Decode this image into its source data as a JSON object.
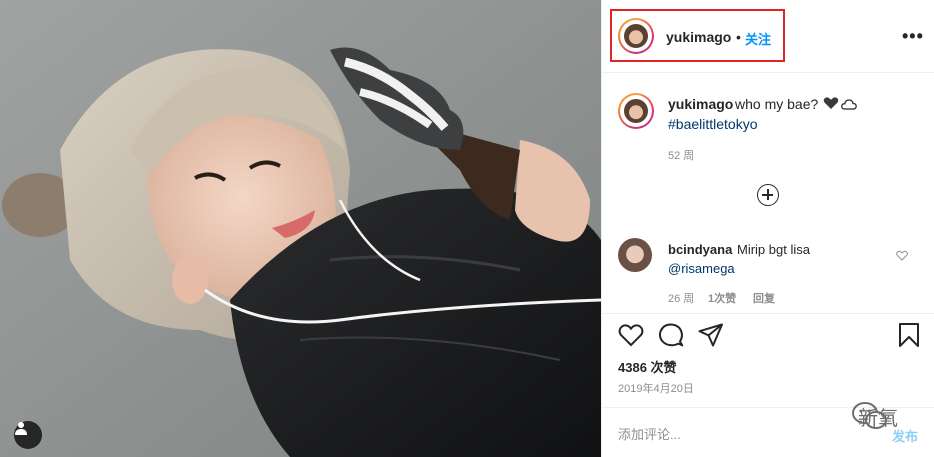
{
  "header": {
    "username": "yukimago",
    "separator": "•",
    "follow_label": "关注",
    "more_label": "•••"
  },
  "caption": {
    "username": "yukimago",
    "text": "who my bae?",
    "hashtag": "#baelittletokyo",
    "time": "52 周"
  },
  "comments": [
    {
      "username": "bcindyana",
      "text": "Mirip bgt lisa",
      "mention": "@risamega",
      "time": "26 周",
      "likes": "1次赞",
      "reply_label": "回复"
    }
  ],
  "stats": {
    "likes": "4386 次赞",
    "date": "2019年4月20日"
  },
  "composer": {
    "placeholder": "添加评论...",
    "post_label": "发布"
  },
  "watermark": {
    "text": "新氧"
  },
  "icons": {
    "user_tag": "user-icon",
    "like": "heart-icon",
    "comment": "comment-icon",
    "share": "paper-plane-icon",
    "save": "bookmark-icon",
    "load_more": "plus-circle-icon",
    "comment_like": "heart-outline-icon",
    "caption_heart": "black-heart-icon",
    "caption_cloud": "cloud-icon"
  },
  "colors": {
    "highlight": "#e02424",
    "link": "#0095f6",
    "hashtag": "#00376b",
    "muted": "#8e8e8e"
  }
}
